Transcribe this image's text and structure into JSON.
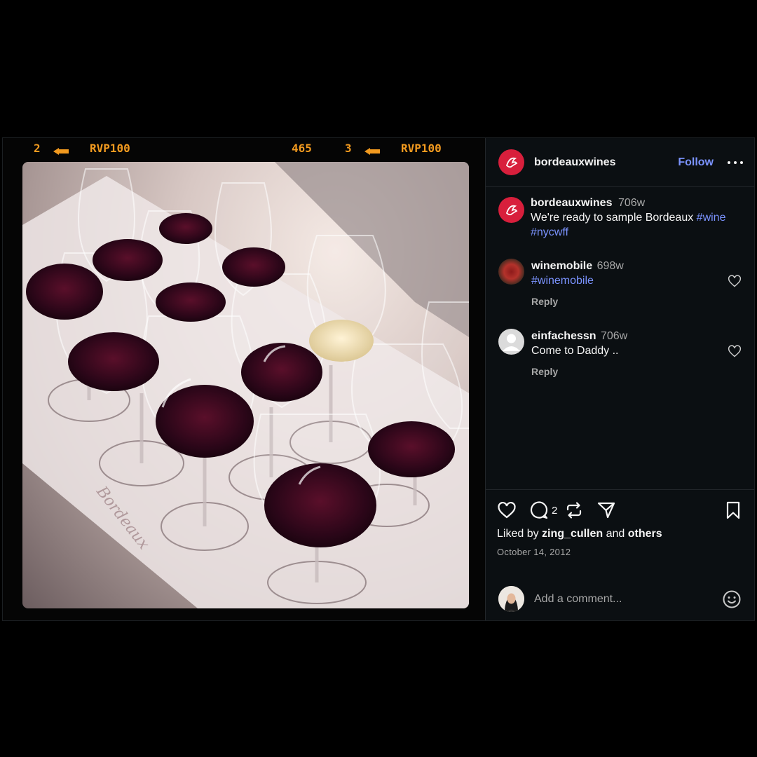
{
  "filmstrip": {
    "frame_a": "2",
    "code_a": "RVP100",
    "number": "465",
    "frame_b": "3",
    "code_b": "RVP100"
  },
  "photo": {
    "icon": "wine-glasses-photo"
  },
  "header": {
    "username": "bordeauxwines",
    "follow_label": "Follow",
    "more_icon": "more-icon"
  },
  "caption": {
    "username": "bordeauxwines",
    "time": "706w",
    "text": "We're ready to sample Bordeaux",
    "tags": [
      "#wine",
      "#nycwff"
    ]
  },
  "comments": [
    {
      "username": "winemobile",
      "time": "698w",
      "text": "#winemobile",
      "reply_label": "Reply"
    },
    {
      "username": "einfachessn",
      "time": "706w",
      "text": "Come to Daddy ..",
      "reply_label": "Reply"
    }
  ],
  "actions": {
    "comment_count": "2",
    "liked_prefix": "Liked by",
    "liked_user": "zing_cullen",
    "liked_and": "and",
    "liked_others": "others",
    "date": "October 14, 2012"
  },
  "add_comment": {
    "placeholder": "Add a comment..."
  },
  "colors": {
    "accent_link": "#7b93ff",
    "brand_red": "#d81f3c",
    "filmstrip_orange": "#f29a1f",
    "panel_bg": "#0b0f12"
  }
}
